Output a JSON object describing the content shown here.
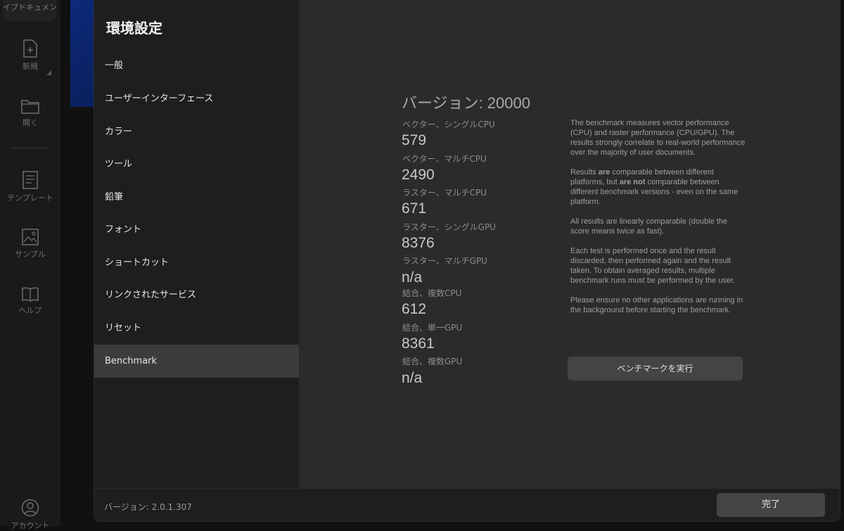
{
  "rail": {
    "top_label": "イプドキュメン",
    "items": [
      {
        "label": "新規",
        "icon": "new-document-icon"
      },
      {
        "label": "開く",
        "icon": "folder-icon"
      },
      {
        "label": "テンプレート",
        "icon": "template-icon"
      },
      {
        "label": "サンプル",
        "icon": "image-icon"
      },
      {
        "label": "ヘルプ",
        "icon": "book-icon"
      },
      {
        "label": "アカウント",
        "icon": "account-icon"
      }
    ]
  },
  "dialog": {
    "title": "環境設定",
    "nav": [
      {
        "label": "一般"
      },
      {
        "label": "ユーザーインターフェース"
      },
      {
        "label": "カラー"
      },
      {
        "label": "ツール"
      },
      {
        "label": "鉛筆"
      },
      {
        "label": "フォント"
      },
      {
        "label": "ショートカット"
      },
      {
        "label": "リンクされたサービス"
      },
      {
        "label": "リセット"
      },
      {
        "label": "Benchmark",
        "active": true
      }
    ],
    "footer_version": "バージョン: 2.0.1.307",
    "done_label": "完了"
  },
  "benchmark": {
    "version": "バージョン: 20000",
    "scores": [
      {
        "label": "ベクター、シングルCPU",
        "value": "579"
      },
      {
        "label": "ベクター、マルチCPU",
        "value": "2490"
      },
      {
        "label": "ラスター、マルチCPU",
        "value": "671"
      },
      {
        "label": "ラスター、シングルGPU",
        "value": "8376"
      },
      {
        "label": "ラスター、マルチGPU",
        "value": "n/a"
      },
      {
        "label": "結合、複数CPU",
        "value": "612"
      },
      {
        "label": "結合、単一GPU",
        "value": "8361"
      },
      {
        "label": "結合、複数GPU",
        "value": "n/a"
      }
    ],
    "description": {
      "p1": "The benchmark measures vector performance (CPU) and raster performance (CPU/GPU). The results strongly correlate to real-world performance over the majority of user documents.",
      "p2_a": "Results ",
      "p2_b": "are",
      "p2_c": " comparable between different platforms, but ",
      "p2_d": "are not",
      "p2_e": " comparable between different benchmark versions - even on the same platform.",
      "p3": "All results are linearly comparable (double the score means twice as fast).",
      "p4": "Each test is performed once and the result discarded, then performed again and the result taken. To obtain averaged results, multiple benchmark runs must be performed by the user.",
      "p5": "Please ensure no other applications are running in the background before starting the benchmark."
    },
    "run_label": "ベンチマークを実行"
  }
}
